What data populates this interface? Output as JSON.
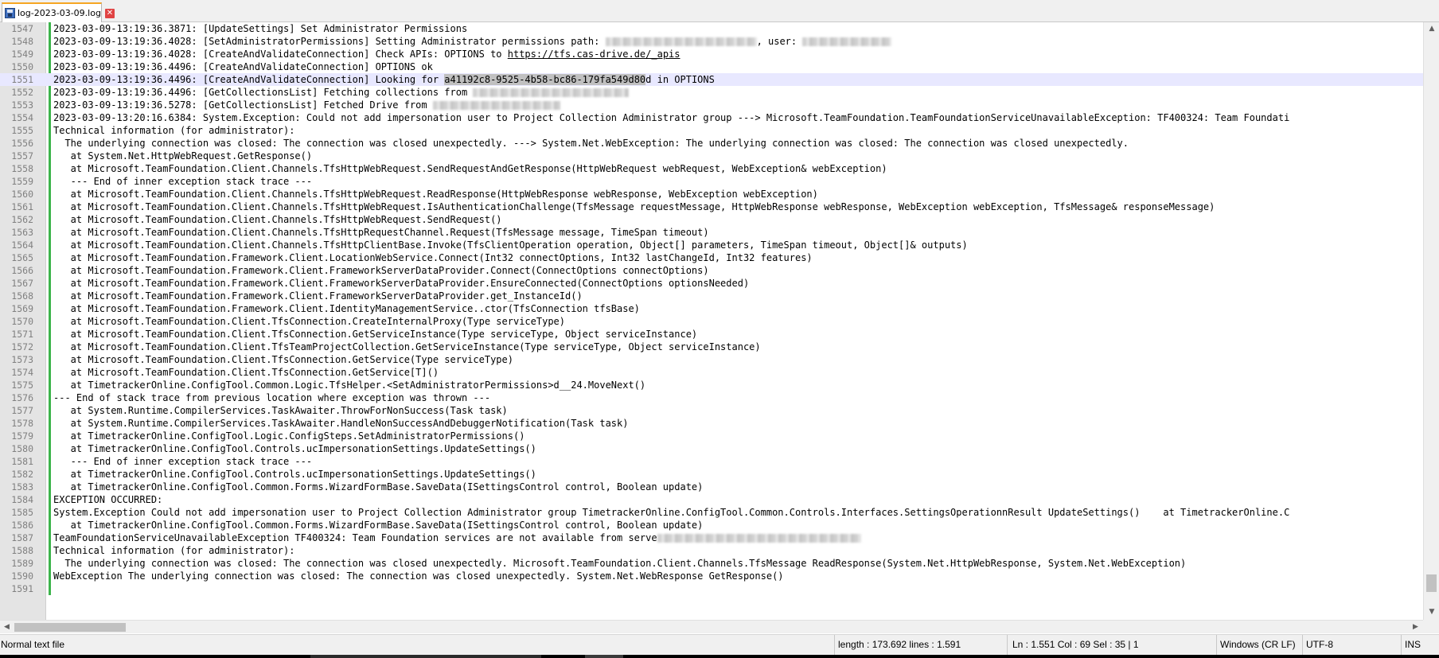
{
  "tab": {
    "title": "log-2023-03-09.log",
    "close_glyph": "✕"
  },
  "editor": {
    "current_line": "1551",
    "lines": [
      {
        "n": "1547",
        "parts": [
          {
            "t": "2023-03-09-13:19:36.3871: [UpdateSettings] Set Administrator Permissions"
          }
        ]
      },
      {
        "n": "1548",
        "parts": [
          {
            "t": "2023-03-09-13:19:36.4028: [SetAdministratorPermissions] Setting Administrator permissions path: "
          },
          {
            "redact": true,
            "w": 190
          },
          {
            "t": ", user: "
          },
          {
            "redact": true,
            "w": 112
          }
        ]
      },
      {
        "n": "1549",
        "parts": [
          {
            "t": "2023-03-09-13:19:36.4028: [CreateAndValidateConnection] Check APIs: OPTIONS to "
          },
          {
            "t": "https://tfs.cas-drive.de/_apis",
            "link": true
          }
        ]
      },
      {
        "n": "1550",
        "parts": [
          {
            "t": "2023-03-09-13:19:36.4496: [CreateAndValidateConnection] OPTIONS ok"
          }
        ]
      },
      {
        "n": "1551",
        "current": true,
        "parts": [
          {
            "t": "2023-03-09-13:19:36.4496: [CreateAndValidateConnection] Looking for "
          },
          {
            "t": "a41192c8-9525-4b58-bc86-179fa549d80",
            "sel": true
          },
          {
            "t": "d in OPTIONS"
          }
        ]
      },
      {
        "n": "1552",
        "parts": [
          {
            "t": "2023-03-09-13:19:36.4496: [GetCollectionsList] Fetching collections from "
          },
          {
            "redact": true,
            "w": 196
          }
        ]
      },
      {
        "n": "1553",
        "parts": [
          {
            "t": "2023-03-09-13:19:36.5278: [GetCollectionsList] Fetched Drive from "
          },
          {
            "redact": true,
            "w": 160
          }
        ]
      },
      {
        "n": "1554",
        "parts": [
          {
            "t": "2023-03-09-13:20:16.6384: System.Exception: Could not add impersonation user to Project Collection Administrator group ---> Microsoft.TeamFoundation.TeamFoundationServiceUnavailableException: TF400324: Team Foundati"
          }
        ]
      },
      {
        "n": "1555",
        "parts": [
          {
            "t": "Technical information (for administrator):"
          }
        ]
      },
      {
        "n": "1556",
        "parts": [
          {
            "t": "  The underlying connection was closed: The connection was closed unexpectedly. ---> System.Net.WebException: The underlying connection was closed: The connection was closed unexpectedly."
          }
        ]
      },
      {
        "n": "1557",
        "parts": [
          {
            "t": "   at System.Net.HttpWebRequest.GetResponse()"
          }
        ]
      },
      {
        "n": "1558",
        "parts": [
          {
            "t": "   at Microsoft.TeamFoundation.Client.Channels.TfsHttpWebRequest.SendRequestAndGetResponse(HttpWebRequest webRequest, WebException& webException)"
          }
        ]
      },
      {
        "n": "1559",
        "parts": [
          {
            "t": "   --- End of inner exception stack trace ---"
          }
        ]
      },
      {
        "n": "1560",
        "parts": [
          {
            "t": "   at Microsoft.TeamFoundation.Client.Channels.TfsHttpWebRequest.ReadResponse(HttpWebResponse webResponse, WebException webException)"
          }
        ]
      },
      {
        "n": "1561",
        "parts": [
          {
            "t": "   at Microsoft.TeamFoundation.Client.Channels.TfsHttpWebRequest.IsAuthenticationChallenge(TfsMessage requestMessage, HttpWebResponse webResponse, WebException webException, TfsMessage& responseMessage)"
          }
        ]
      },
      {
        "n": "1562",
        "parts": [
          {
            "t": "   at Microsoft.TeamFoundation.Client.Channels.TfsHttpWebRequest.SendRequest()"
          }
        ]
      },
      {
        "n": "1563",
        "parts": [
          {
            "t": "   at Microsoft.TeamFoundation.Client.Channels.TfsHttpRequestChannel.Request(TfsMessage message, TimeSpan timeout)"
          }
        ]
      },
      {
        "n": "1564",
        "parts": [
          {
            "t": "   at Microsoft.TeamFoundation.Client.Channels.TfsHttpClientBase.Invoke(TfsClientOperation operation, Object[] parameters, TimeSpan timeout, Object[]& outputs)"
          }
        ]
      },
      {
        "n": "1565",
        "parts": [
          {
            "t": "   at Microsoft.TeamFoundation.Framework.Client.LocationWebService.Connect(Int32 connectOptions, Int32 lastChangeId, Int32 features)"
          }
        ]
      },
      {
        "n": "1566",
        "parts": [
          {
            "t": "   at Microsoft.TeamFoundation.Framework.Client.FrameworkServerDataProvider.Connect(ConnectOptions connectOptions)"
          }
        ]
      },
      {
        "n": "1567",
        "parts": [
          {
            "t": "   at Microsoft.TeamFoundation.Framework.Client.FrameworkServerDataProvider.EnsureConnected(ConnectOptions optionsNeeded)"
          }
        ]
      },
      {
        "n": "1568",
        "parts": [
          {
            "t": "   at Microsoft.TeamFoundation.Framework.Client.FrameworkServerDataProvider.get_InstanceId()"
          }
        ]
      },
      {
        "n": "1569",
        "parts": [
          {
            "t": "   at Microsoft.TeamFoundation.Framework.Client.IdentityManagementService..ctor(TfsConnection tfsBase)"
          }
        ]
      },
      {
        "n": "1570",
        "parts": [
          {
            "t": "   at Microsoft.TeamFoundation.Client.TfsConnection.CreateInternalProxy(Type serviceType)"
          }
        ]
      },
      {
        "n": "1571",
        "parts": [
          {
            "t": "   at Microsoft.TeamFoundation.Client.TfsConnection.GetServiceInstance(Type serviceType, Object serviceInstance)"
          }
        ]
      },
      {
        "n": "1572",
        "parts": [
          {
            "t": "   at Microsoft.TeamFoundation.Client.TfsTeamProjectCollection.GetServiceInstance(Type serviceType, Object serviceInstance)"
          }
        ]
      },
      {
        "n": "1573",
        "parts": [
          {
            "t": "   at Microsoft.TeamFoundation.Client.TfsConnection.GetService(Type serviceType)"
          }
        ]
      },
      {
        "n": "1574",
        "parts": [
          {
            "t": "   at Microsoft.TeamFoundation.Client.TfsConnection.GetService[T]()"
          }
        ]
      },
      {
        "n": "1575",
        "parts": [
          {
            "t": "   at TimetrackerOnline.ConfigTool.Common.Logic.TfsHelper.<SetAdministratorPermissions>d__24.MoveNext()"
          }
        ]
      },
      {
        "n": "1576",
        "parts": [
          {
            "t": "--- End of stack trace from previous location where exception was thrown ---"
          }
        ]
      },
      {
        "n": "1577",
        "parts": [
          {
            "t": "   at System.Runtime.CompilerServices.TaskAwaiter.ThrowForNonSuccess(Task task)"
          }
        ]
      },
      {
        "n": "1578",
        "parts": [
          {
            "t": "   at System.Runtime.CompilerServices.TaskAwaiter.HandleNonSuccessAndDebuggerNotification(Task task)"
          }
        ]
      },
      {
        "n": "1579",
        "parts": [
          {
            "t": "   at TimetrackerOnline.ConfigTool.Logic.ConfigSteps.SetAdministratorPermissions()"
          }
        ]
      },
      {
        "n": "1580",
        "parts": [
          {
            "t": "   at TimetrackerOnline.ConfigTool.Controls.ucImpersonationSettings.UpdateSettings()"
          }
        ]
      },
      {
        "n": "1581",
        "parts": [
          {
            "t": "   --- End of inner exception stack trace ---"
          }
        ]
      },
      {
        "n": "1582",
        "parts": [
          {
            "t": "   at TimetrackerOnline.ConfigTool.Controls.ucImpersonationSettings.UpdateSettings()"
          }
        ]
      },
      {
        "n": "1583",
        "parts": [
          {
            "t": "   at TimetrackerOnline.ConfigTool.Common.Forms.WizardFormBase.SaveData(ISettingsControl control, Boolean update)"
          }
        ]
      },
      {
        "n": "1584",
        "parts": [
          {
            "t": "EXCEPTION OCCURRED:"
          }
        ]
      },
      {
        "n": "1585",
        "parts": [
          {
            "t": "System.Exception Could not add impersonation user to Project Collection Administrator group TimetrackerOnline.ConfigTool.Common.Controls.Interfaces.SettingsOperationnResult UpdateSettings()    at TimetrackerOnline.C"
          }
        ]
      },
      {
        "n": "1586",
        "parts": [
          {
            "t": "   at TimetrackerOnline.ConfigTool.Common.Forms.WizardFormBase.SaveData(ISettingsControl control, Boolean update)"
          }
        ]
      },
      {
        "n": "1587",
        "parts": [
          {
            "t": "TeamFoundationServiceUnavailableException TF400324: Team Foundation services are not available from serve"
          },
          {
            "redact": true,
            "w": 256
          }
        ]
      },
      {
        "n": "1588",
        "parts": [
          {
            "t": "Technical information (for administrator):"
          }
        ]
      },
      {
        "n": "1589",
        "parts": [
          {
            "t": "  The underlying connection was closed: The connection was closed unexpectedly. Microsoft.TeamFoundation.Client.Channels.TfsMessage ReadResponse(System.Net.HttpWebResponse, System.Net.WebException)"
          }
        ]
      },
      {
        "n": "1590",
        "parts": [
          {
            "t": "WebException The underlying connection was closed: The connection was closed unexpectedly. System.Net.WebResponse GetResponse()"
          }
        ]
      },
      {
        "n": "1591",
        "parts": [
          {
            "t": ""
          }
        ]
      }
    ]
  },
  "scrollbars": {
    "up_glyph": "▲",
    "down_glyph": "▼",
    "left_glyph": "◀",
    "right_glyph": "▶"
  },
  "statusbar": {
    "file_type": "Normal text file",
    "length_lines": "length : 173.692    lines : 1.591",
    "position": "Ln : 1.551    Col : 69    Sel : 35 | 1",
    "eol": "Windows (CR LF)",
    "encoding": "UTF-8",
    "mode": "INS"
  },
  "colors": {
    "tab_accent": "#f5a623",
    "change_bar": "#3cb44b",
    "current_line_bg": "#e8e8ff",
    "selection_bg": "#c0c0c0"
  }
}
